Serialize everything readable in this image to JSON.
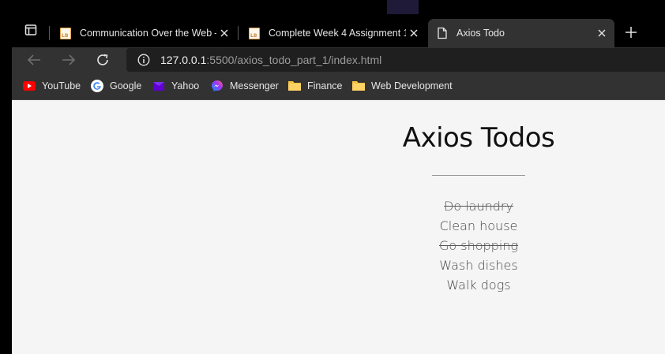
{
  "browser": {
    "tabs": [
      {
        "title": "Communication Over the Web –",
        "favicon": "lb-logo-icon",
        "active": false
      },
      {
        "title": "Complete Week 4 Assignment 1:",
        "favicon": "lb-logo-icon",
        "active": false
      },
      {
        "title": "Axios Todo",
        "favicon": "page-icon",
        "active": true
      }
    ],
    "address": {
      "host": "127.0.0.1",
      "rest": ":5500/axios_todo_part_1/index.html"
    },
    "bookmarks": [
      {
        "label": "YouTube",
        "icon": "youtube-icon"
      },
      {
        "label": "Google",
        "icon": "google-icon"
      },
      {
        "label": "Yahoo",
        "icon": "yahoo-icon"
      },
      {
        "label": "Messenger",
        "icon": "messenger-icon"
      },
      {
        "label": "Finance",
        "icon": "folder-icon"
      },
      {
        "label": "Web Development",
        "icon": "folder-icon"
      }
    ]
  },
  "page": {
    "title": "Axios Todos",
    "todos": [
      {
        "text": "Do laundry",
        "completed": true
      },
      {
        "text": "Clean house",
        "completed": false
      },
      {
        "text": "Go shopping",
        "completed": true
      },
      {
        "text": "Wash dishes",
        "completed": false
      },
      {
        "text": "Walk dogs",
        "completed": false
      }
    ]
  },
  "colors": {
    "chrome_dark": "#000000",
    "chrome_toolbar": "#323232",
    "omnibox": "#1f1f1f",
    "page_bg": "#f5f5f5"
  }
}
